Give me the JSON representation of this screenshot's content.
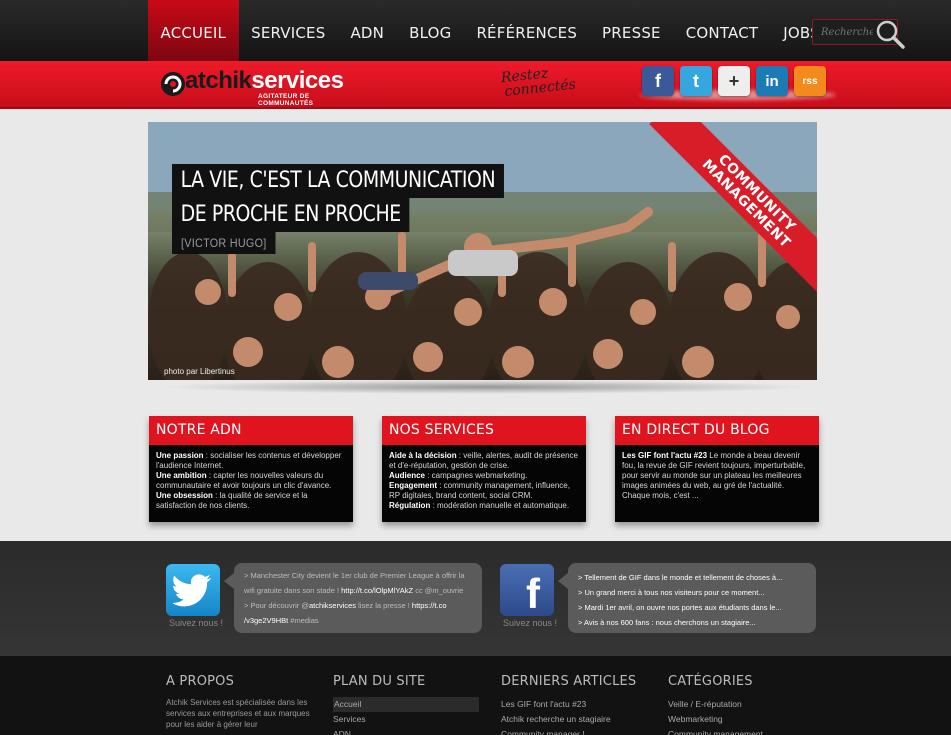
{
  "nav": {
    "items": [
      "ACCUEIL",
      "SERVICES",
      "ADN",
      "BLOG",
      "RÉFÉRENCES",
      "PRESSE",
      "CONTACT",
      "JOBS"
    ],
    "active": "ACCUEIL",
    "search_placeholder": "Recherche"
  },
  "brand": {
    "name_part1": "atchik",
    "name_part2": "services",
    "tagline": "AGITATEUR DE COMMUNAUTÉS",
    "restez_line1": "Restez",
    "restez_line2": "connectés"
  },
  "social": [
    "f",
    "t",
    "+",
    "in",
    "rss"
  ],
  "hero": {
    "quote_line1": "LA VIE, C'EST LA COMMUNICATION",
    "quote_line2": "DE PROCHE EN PROCHE",
    "author": "[VICTOR HUGO]",
    "credit": "photo par Libertinus",
    "ribbon_line1": "COMMUNITY",
    "ribbon_line2": "MANAGEMENT"
  },
  "cards": {
    "adn": {
      "title": "NOTRE ADN",
      "items": [
        {
          "label": "Une passion",
          "text": " : socialiser les contenus et développer l'audience Internet."
        },
        {
          "label": "Une ambition",
          "text": " : capter les nouvelles valeurs du communautaire et avoir toujours un clic d'avance."
        },
        {
          "label": "Une obsession",
          "text": " : la qualité de service et la satisfaction de nos clients."
        }
      ]
    },
    "services": {
      "title": "NOS SERVICES",
      "items": [
        {
          "label": "Aide à la décision",
          "text": " : veille, alertes, audit de présence et d'e-réputation, gestion de crise."
        },
        {
          "label": "Audience",
          "text": " : campagnes webmarketing."
        },
        {
          "label": "Engagement",
          "text": " : community management, influence, RP digitales, brand content, social CRM."
        },
        {
          "label": "Régulation",
          "text": " : modération manuelle et automatique."
        }
      ]
    },
    "blog": {
      "title": "EN DIRECT DU BLOG",
      "label": "Les GIF font l'actu #23",
      "text": " Le monde a beau devenir fou, la revue de GIF revient toujours, imperturbable, pour servir au monde sur un plateau les meilleures images animées du web, au gré de l'actualité. Chaque mois, c'est ..."
    }
  },
  "twitter": {
    "suivez": "Suivez nous !",
    "line1": "> Manchester City devient le 1er club de Premier League à offrir la",
    "line2a": "wifi gratuite dans son stade ! ",
    "line2b": "http://t.co/lOlpMlYAkZ",
    "line2c": " cc @m_ouvrie",
    "line3a": "> Pour découvrir @",
    "line3b": "atchikservices",
    "line3c": " lisez la presse ! ",
    "line3d": "https://t.co",
    "line4a": "/v3ge2V9HBt",
    "line4b": " #medias"
  },
  "facebook": {
    "suivez": "Suivez nous !",
    "posts": [
      "> Tellement de GIF dans le monde et tellement de choses à...",
      "> Un grand merci à tous nos visiteurs pour ce moment...",
      "> Mardi 1er avril, on ouvre nos portes aux étudiants dans le...",
      "> Avis à nos 600 fans : nous cherchons un stagiaire..."
    ]
  },
  "footer": {
    "apropos": {
      "title": "A PROPOS",
      "text": "Atchik Services est spécialisée dans les services aux entreprises et aux marques pour les aider à gérer leur"
    },
    "plan": {
      "title": "PLAN DU SITE",
      "links": [
        "Accueil",
        "Services",
        "ADN"
      ]
    },
    "articles": {
      "title": "DERNIERS ARTICLES",
      "links": [
        "Les GIF font l'actu #23",
        "Atchik recherche un stagiaire",
        "Community manager !"
      ]
    },
    "categories": {
      "title": "CATÉGORIES",
      "links": [
        "Veille / E-réputation",
        "Webmarketing",
        "Community management"
      ]
    }
  }
}
